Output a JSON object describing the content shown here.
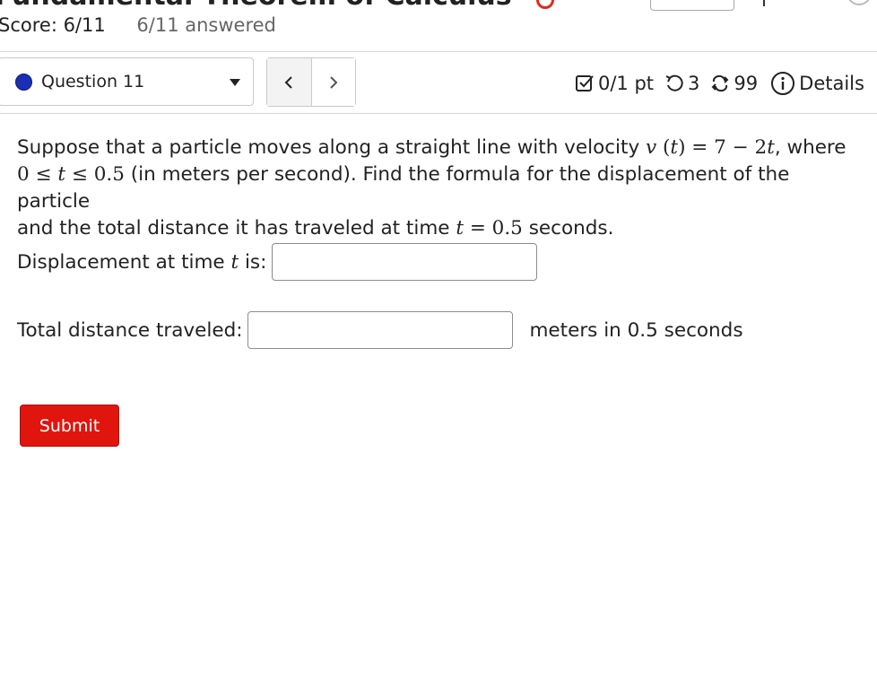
{
  "header": {
    "assignment_title": "Fundamental Theorem of Calculus",
    "score": "Score: 6/11",
    "answered": "6/11 answered"
  },
  "question_nav": {
    "selected": "Question 11",
    "prev_label": "<",
    "next_label": ">"
  },
  "meta": {
    "points": "0/1 pt",
    "attempts": "3",
    "retries": "99",
    "details": "Details"
  },
  "question": {
    "text_1": "Suppose that a particle moves along a straight line with velocity ",
    "text_2": ", where",
    "text_3": " (in meters per second). Find the formula for the displacement of the particle",
    "text_4": "and the total distance it has traveled at time ",
    "text_5": " seconds."
  },
  "answers": {
    "displacement_label_a": "Displacement at time ",
    "displacement_label_b": " is:",
    "displacement_value": "",
    "distance_label": "Total distance traveled:",
    "distance_value": "",
    "distance_units": "meters in 0.5 seconds"
  },
  "submit_label": "Submit",
  "colors": {
    "submit_bg": "#e0150d",
    "status_dot": "#1b2fb4",
    "text": "#222222",
    "muted": "#666666"
  }
}
